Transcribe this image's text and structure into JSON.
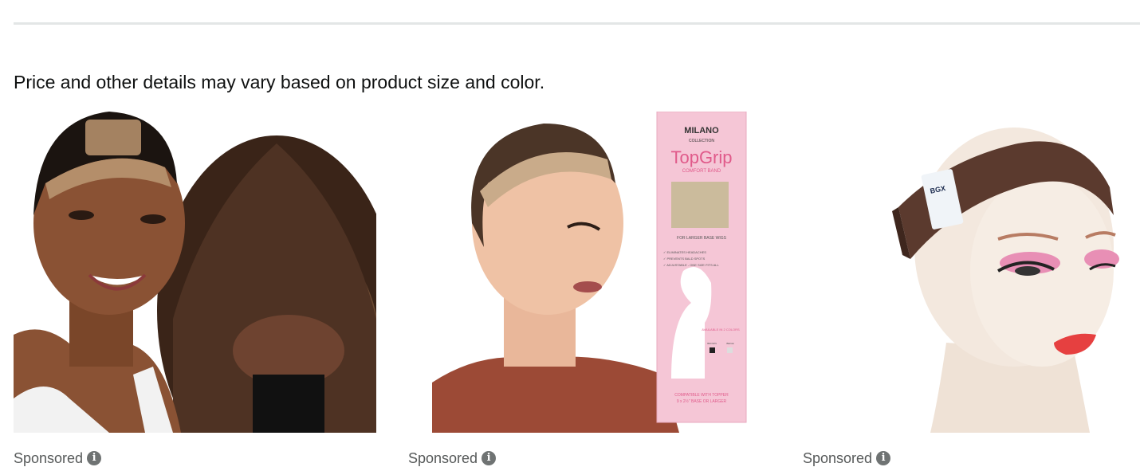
{
  "notice_text": "Price and other details may vary based on product size and color.",
  "products": [
    {
      "sponsored_label": "Sponsored",
      "image_icon": "wig-cap-model-photo"
    },
    {
      "sponsored_label": "Sponsored",
      "image_icon": "wig-grip-band-package-photo",
      "package": {
        "brand": "MILANO",
        "brand_sub": "COLLECTION",
        "product": "TopGrip",
        "product_sub": "COMFORT BAND",
        "tagline": "FOR LARGER BASE WIGS",
        "bullets": [
          "✓ ELIMINATES HEADACHES",
          "✓ PREVENTS BALD SPOTS",
          "✓ ADJUSTABLE - ONE SIZE FITS ALL"
        ],
        "colors_note": "AVAILABLE IN 2 COLORS",
        "color_brown": "BROWN",
        "color_beige": "BEIGE",
        "compat": "COMPATIBLE WITH TOPPER",
        "compat_sub": "9 x 2½\" BASE OR LARGER"
      }
    },
    {
      "sponsored_label": "Sponsored",
      "image_icon": "velvet-headband-mannequin-photo",
      "tag": "BGX"
    }
  ],
  "colors": {
    "divider": "#e3e6e6",
    "text": "#0f1111",
    "muted": "#565959",
    "package_pink": "#f5c6d6",
    "band_brown": "#5b3a2e"
  }
}
